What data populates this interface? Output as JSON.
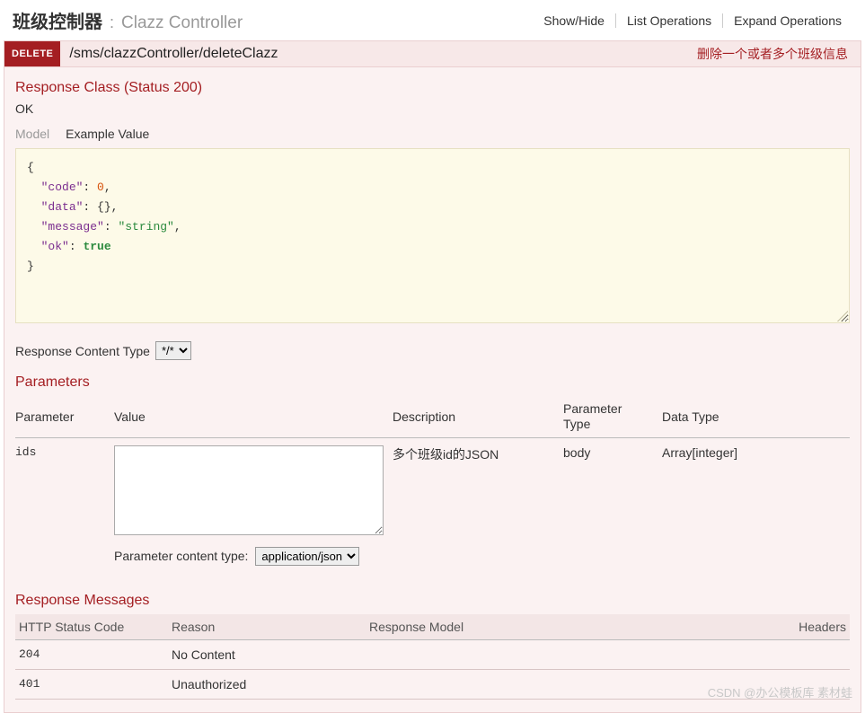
{
  "header": {
    "controller_name": "班级控制器",
    "separator": ":",
    "controller_desc": "Clazz Controller",
    "ops": {
      "show_hide": "Show/Hide",
      "list_ops": "List Operations",
      "expand_ops": "Expand Operations"
    }
  },
  "operation": {
    "method": "DELETE",
    "path": "/sms/clazzController/deleteClazz",
    "summary": "删除一个或者多个班级信息"
  },
  "response_class": {
    "title": "Response Class (Status 200)",
    "ok": "OK",
    "tabs": {
      "model": "Model",
      "example": "Example Value"
    },
    "example_json": {
      "code": 0,
      "data": {},
      "message": "string",
      "ok": true
    }
  },
  "content_type": {
    "label": "Response Content Type",
    "value": "*/*"
  },
  "parameters": {
    "title": "Parameters",
    "headers": {
      "parameter": "Parameter",
      "value": "Value",
      "description": "Description",
      "param_type": "Parameter Type",
      "data_type": "Data Type"
    },
    "rows": [
      {
        "name": "ids",
        "value": "",
        "description": "多个班级id的JSON",
        "param_type": "body",
        "data_type": "Array[integer]"
      }
    ],
    "content_type_label": "Parameter content type:",
    "content_type_value": "application/json"
  },
  "response_messages": {
    "title": "Response Messages",
    "headers": {
      "status": "HTTP Status Code",
      "reason": "Reason",
      "model": "Response Model",
      "headers": "Headers"
    },
    "rows": [
      {
        "status": "204",
        "reason": "No Content",
        "model": "",
        "headers": ""
      },
      {
        "status": "401",
        "reason": "Unauthorized",
        "model": "",
        "headers": ""
      }
    ]
  },
  "watermark": "CSDN @办公模板库 素材蛙"
}
